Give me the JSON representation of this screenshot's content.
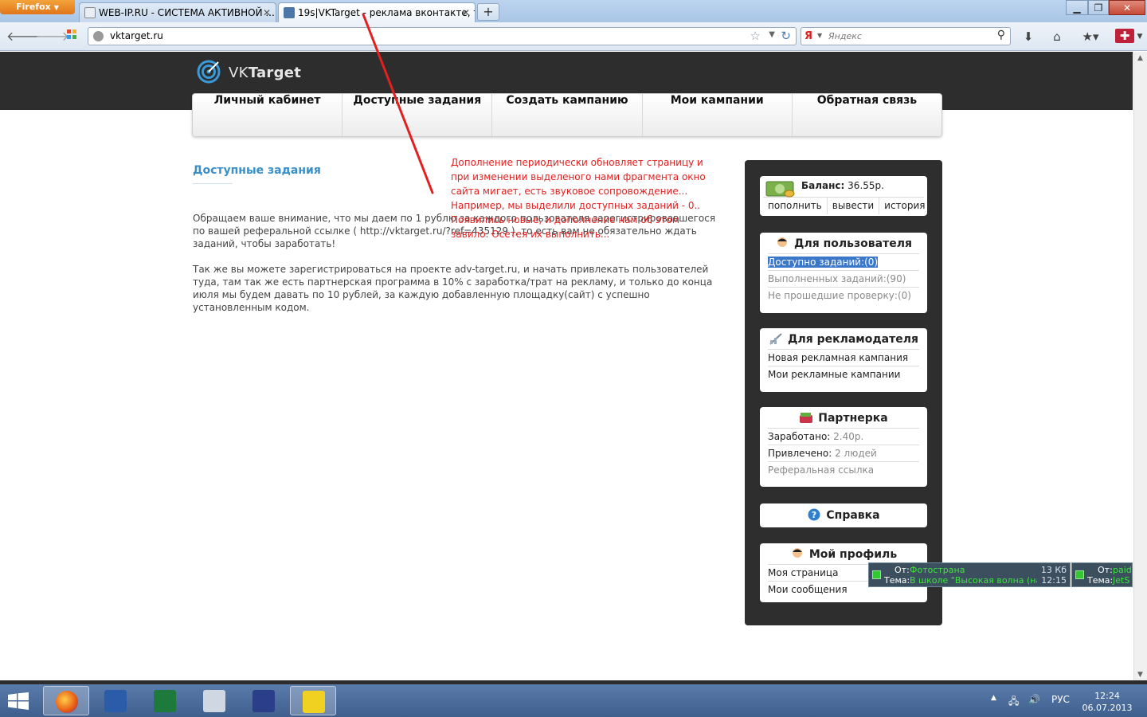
{
  "browser": {
    "menu_button": "Firefox",
    "tabs": [
      {
        "label": "WEB-IP.RU - СИСТЕМА АКТИВНОЙ ..."
      },
      {
        "label": "19s|VKTarget - реклама вконтакте, т..."
      }
    ],
    "url": "vktarget.ru",
    "search_placeholder": "Яндекс",
    "search_engine": "Я"
  },
  "site": {
    "logo_vk": "VK",
    "logo_target": "Target",
    "menu": [
      "Личный кабинет",
      "Доступные задания",
      "Создать кампанию",
      "Мои кампании",
      "Обратная связь"
    ]
  },
  "main": {
    "title": "Доступные задания",
    "paragraph1": "Обращаем ваше внимание, что мы даем по 1 рублю за каждого пользователя зарегистрировавшегося по вашей реферальной ссылке ( http://vktarget.ru/?ref=435129 ), то есть вам не обязательно ждать заданий, чтобы заработать!",
    "paragraph2": "Так же вы можете зарегистрироваться на проекте adv-target.ru, и начать привлекать пользователей туда, там так же есть партнерская программа в 10% с заработка/трат на рекламу, и только до конца июля мы будем давать по 10 рублей, за каждую добавленную площадку(сайт) с успешно установленным кодом."
  },
  "annotation": {
    "text": "Дополнение периодически обновляет страницу и при изменении выделеного нами фрагмента окно сайта мигает, есть звуковое сопровождение... Например, мы выделили доступных заданий - 0.. Появились новые, и дополнение нам об этом завило.  Осетея их выполнить..."
  },
  "sidebar": {
    "balance": {
      "label": "Баланс:",
      "value": "36.55р.",
      "links": [
        "пополнить",
        "вывести",
        "история"
      ]
    },
    "user": {
      "title": "Для пользователя",
      "available": "Доступно заданий:(0)",
      "completed_label": "Выполненных заданий:",
      "completed_value": "(90)",
      "unchecked_label": "Не прошедшие проверку:",
      "unchecked_value": "(0)"
    },
    "advertiser": {
      "title": "Для рекламодателя",
      "items": [
        "Новая рекламная кампания",
        "Мои рекламные кампании"
      ]
    },
    "partner": {
      "title": "Партнерка",
      "earned_label": "Заработано:",
      "earned_value": "2.40р.",
      "invited_label": "Привлечено:",
      "invited_value": "2 людей",
      "ref_link": "Реферальная ссылка"
    },
    "help": {
      "title": "Справка"
    },
    "profile": {
      "title": "Мой профиль",
      "items": [
        "Моя страница",
        "Мои сообщения"
      ]
    }
  },
  "notifications": [
    {
      "from_label": "От:",
      "from": "Фотострана",
      "subject_label": "Тема:",
      "subject": "В школе \"Высокая волна (на...",
      "size": "13 Кб",
      "time": "12:15"
    },
    {
      "from_label": "От:",
      "from": "paid",
      "subject_label": "Тема:",
      "subject": "JetS"
    }
  ],
  "taskbar": {
    "lang": "РУС",
    "time": "12:24",
    "date": "06.07.2013"
  },
  "colors": {
    "header_bg": "#2d2d2d",
    "title_blue": "#3a8fc8",
    "annotation_red": "#e32020",
    "highlight": "#3b77c9"
  }
}
